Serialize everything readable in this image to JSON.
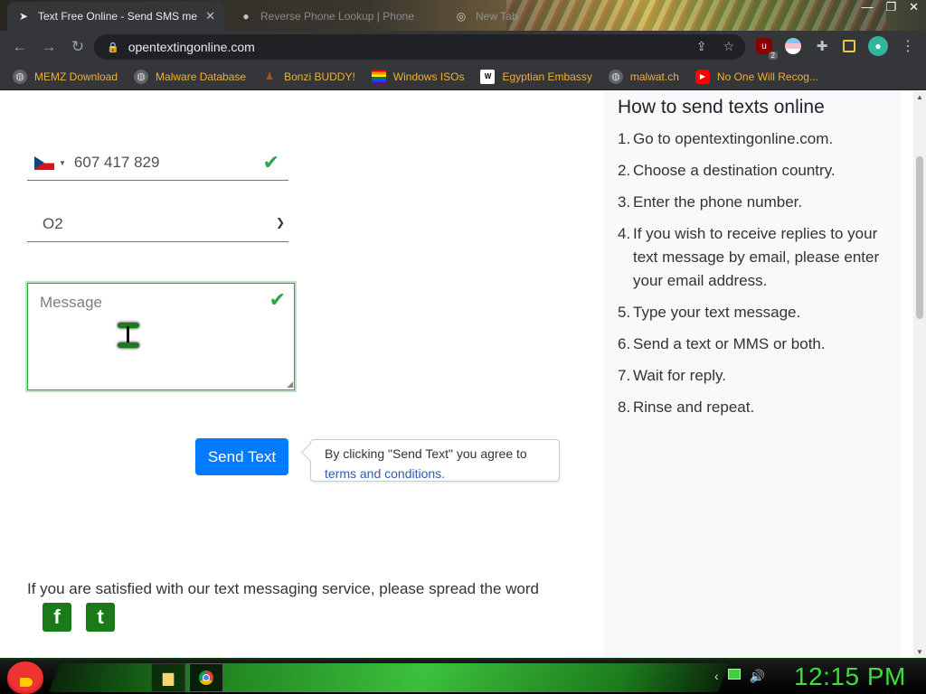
{
  "browser": {
    "tabs": [
      {
        "title": "Text Free Online - Send SMS me",
        "icon": "send-arrow-icon",
        "active": true
      },
      {
        "title": "Reverse Phone Lookup | Phone",
        "icon": "person-icon",
        "active": false
      },
      {
        "title": "New Tab",
        "icon": "chrome-icon",
        "active": false
      }
    ],
    "close_glyph": "✕",
    "url": "opentextingonline.com",
    "bookmarks": [
      {
        "label": "MEMZ Download",
        "icon": "globe-icon"
      },
      {
        "label": "Malware Database",
        "icon": "globe-icon"
      },
      {
        "label": "Bonzi BUDDY!",
        "icon": "bonzi-icon"
      },
      {
        "label": "Windows ISOs",
        "icon": "rainbow-flag-icon"
      },
      {
        "label": "Egyptian Embassy",
        "icon": "wix-icon"
      },
      {
        "label": "malwat.ch",
        "icon": "globe-icon"
      },
      {
        "label": "No One Will Recog...",
        "icon": "youtube-icon"
      }
    ],
    "extension_badge": "2"
  },
  "form": {
    "phone_number": "607 417 829",
    "country": "Czech Republic",
    "carrier": "O2",
    "message_placeholder": "Message",
    "send_label": "Send Text",
    "tooltip_text": "By clicking \"Send Text\" you agree to",
    "tooltip_link": "terms and conditions."
  },
  "sidebar": {
    "title": "How to send texts online",
    "steps": [
      {
        "num": "1.",
        "text": "Go to opentextingonline.com."
      },
      {
        "num": "2.",
        "text": "Choose a destination country."
      },
      {
        "num": "3.",
        "text": "Enter the phone number."
      },
      {
        "num": "4.",
        "text": "If you wish to receive replies to your text message by email, please enter your email address."
      },
      {
        "num": "5.",
        "text": "Type your text message."
      },
      {
        "num": "6.",
        "text": "Send a text or MMS or both."
      },
      {
        "num": "7.",
        "text": "Wait for reply."
      },
      {
        "num": "8.",
        "text": "Rinse and repeat."
      }
    ]
  },
  "footer": {
    "spread_text": "If you are satisfied with our text messaging service, please spread the word",
    "social": [
      {
        "name": "facebook",
        "glyph": "f"
      },
      {
        "name": "twitter",
        "glyph": "t"
      }
    ]
  },
  "taskbar": {
    "clock": "12:15 PM"
  },
  "colors": {
    "valid_green": "#28a745",
    "send_blue": "#007bff",
    "link_blue": "#2a5db0",
    "bookmark_orange": "#f0b030",
    "clock_green": "#3ddc3d"
  }
}
